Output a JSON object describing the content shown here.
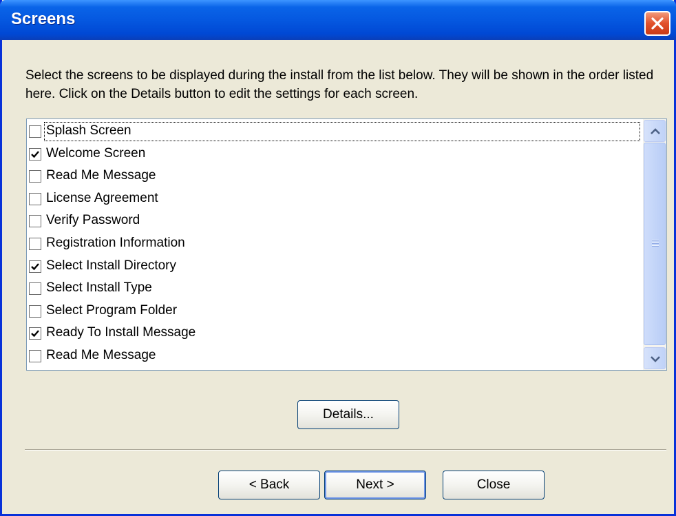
{
  "window": {
    "title": "Screens"
  },
  "description": "Select the screens to be displayed during the install from the list below. They will be shown in the order listed here. Click on the Details button to edit the settings for each screen.",
  "screens": [
    {
      "label": "Splash Screen",
      "checked": false
    },
    {
      "label": "Welcome Screen",
      "checked": true
    },
    {
      "label": "Read Me Message",
      "checked": false
    },
    {
      "label": "License Agreement",
      "checked": false
    },
    {
      "label": "Verify Password",
      "checked": false
    },
    {
      "label": "Registration Information",
      "checked": false
    },
    {
      "label": "Select Install Directory",
      "checked": true
    },
    {
      "label": "Select Install Type",
      "checked": false
    },
    {
      "label": "Select Program Folder",
      "checked": false
    },
    {
      "label": "Ready To Install Message",
      "checked": true
    },
    {
      "label": "Read Me Message",
      "checked": false
    }
  ],
  "buttons": {
    "details": "Details...",
    "back": "< Back",
    "next": "Next >",
    "close": "Close"
  },
  "colors": {
    "titlebar": "#0558e0",
    "close_button": "#e2512b",
    "dialog_background": "#ece9d8",
    "list_border": "#7f9db9"
  }
}
